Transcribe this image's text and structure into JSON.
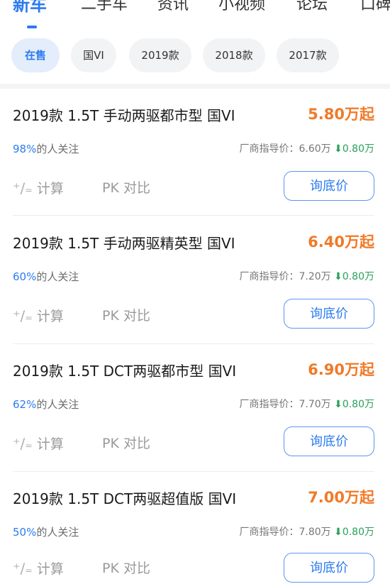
{
  "tabs": [
    {
      "label": "新车"
    },
    {
      "label": "二手车"
    },
    {
      "label": "资讯"
    },
    {
      "label": "小视频"
    },
    {
      "label": "论坛"
    },
    {
      "label": "口碑"
    }
  ],
  "filters": [
    {
      "label": "在售"
    },
    {
      "label": "国VI"
    },
    {
      "label": "2019款"
    },
    {
      "label": "2018款"
    },
    {
      "label": "2017款"
    }
  ],
  "cards": [
    {
      "title": "2019款 1.5T 手动两驱都市型 国VI",
      "price": "5.80万起",
      "attention_pct": "98%",
      "attention_suffix": "的人关注",
      "guide_label": "厂商指导价：",
      "guide_price": "6.60万",
      "discount": "0.80万",
      "calc_label": "计算",
      "pk_prefix": "PK",
      "pk_label": "对比",
      "ask_label": "询底价"
    },
    {
      "title": "2019款 1.5T 手动两驱精英型 国VI",
      "price": "6.40万起",
      "attention_pct": "60%",
      "attention_suffix": "的人关注",
      "guide_label": "厂商指导价：",
      "guide_price": "7.20万",
      "discount": "0.80万",
      "calc_label": "计算",
      "pk_prefix": "PK",
      "pk_label": "对比",
      "ask_label": "询底价"
    },
    {
      "title": "2019款 1.5T DCT两驱都市型 国VI",
      "price": "6.90万起",
      "attention_pct": "62%",
      "attention_suffix": "的人关注",
      "guide_label": "厂商指导价：",
      "guide_price": "7.70万",
      "discount": "0.80万",
      "calc_label": "计算",
      "pk_prefix": "PK",
      "pk_label": "对比",
      "ask_label": "询底价"
    },
    {
      "title": "2019款 1.5T DCT两驱超值版 国VI",
      "price": "7.00万起",
      "attention_pct": "50%",
      "attention_suffix": "的人关注",
      "guide_label": "厂商指导价：",
      "guide_price": "7.80万",
      "discount": "0.80万",
      "calc_label": "计算",
      "pk_prefix": "PK",
      "pk_label": "对比",
      "ask_label": "询底价"
    }
  ],
  "colors": {
    "accent": "#2b7bf0",
    "price": "#f07a28",
    "discount": "#2aa05a"
  }
}
